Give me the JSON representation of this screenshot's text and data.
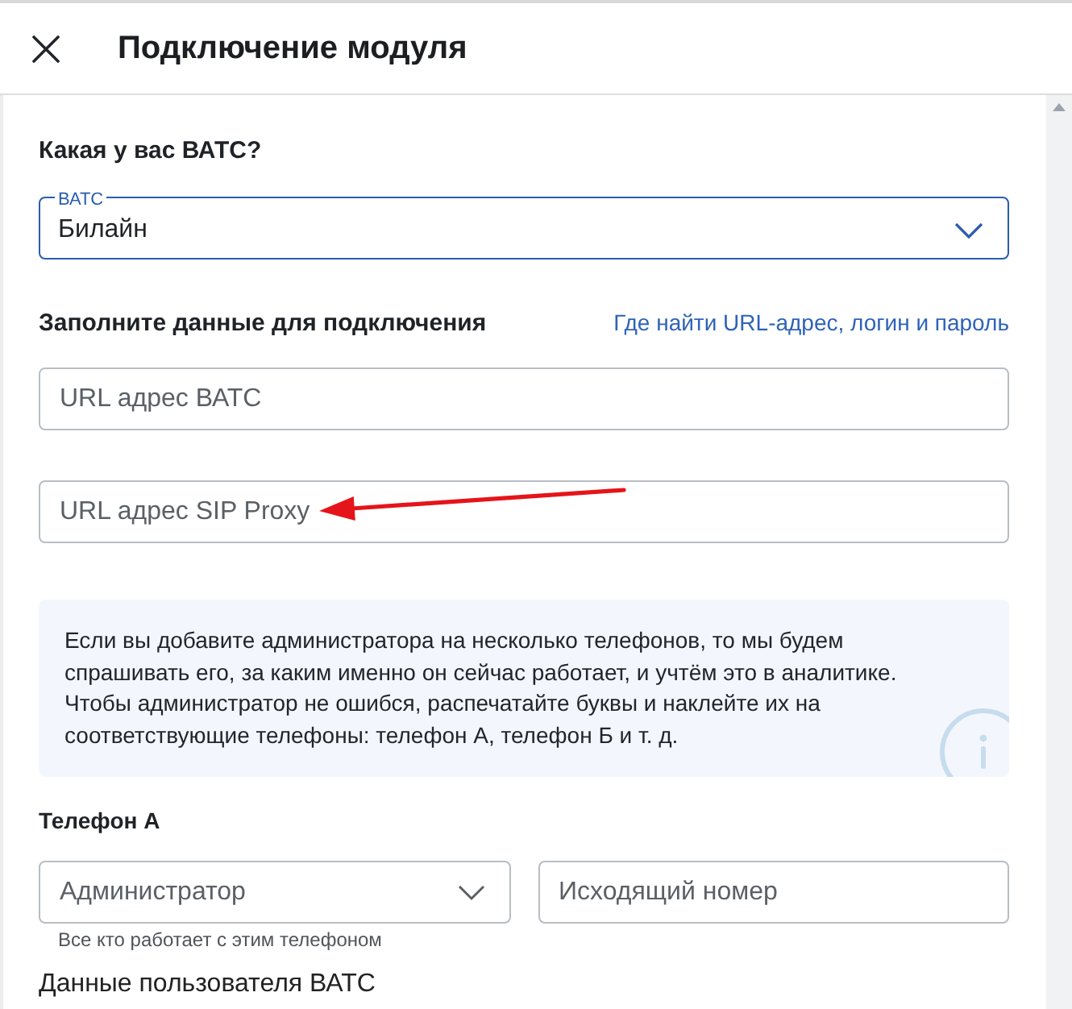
{
  "header": {
    "title": "Подключение модуля"
  },
  "pbx": {
    "heading": "Какая у вас ВАТС?",
    "select": {
      "label": "ВАТС",
      "value": "Билайн",
      "focused": true
    }
  },
  "connection": {
    "heading": "Заполните данные для подключения",
    "help_link": "Где найти URL-адрес, логин и пароль",
    "fields": [
      {
        "placeholder": "URL адрес ВАТС"
      },
      {
        "placeholder": "URL адрес SIP Proxy"
      }
    ]
  },
  "info_note": {
    "text": "Если вы добавите администратора на несколько телефонов, то мы будем спрашивать его, за каким именно он сейчас работает, и учтём это в аналитике. Чтобы администратор не ошибся, распечатайте буквы и наклейте их на соответствующие телефоны: телефон А, телефон Б и т. д."
  },
  "phone": {
    "heading": "Телефон А",
    "role_select": {
      "placeholder": "Администратор",
      "helper": "Все кто работает с этим телефоном"
    },
    "number_field": {
      "placeholder": "Исходящий номер"
    }
  },
  "user_section": {
    "heading": "Данные пользователя ВАТС"
  }
}
